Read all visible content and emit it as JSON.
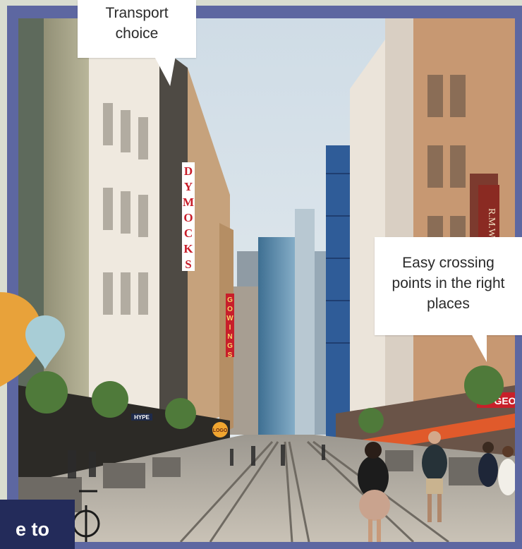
{
  "callouts": {
    "transport": "Transport\nchoice",
    "crossing": "Easy crossing points in the right places"
  },
  "banner": {
    "text": "e to"
  },
  "signs": {
    "dymocks": [
      "D",
      "Y",
      "M",
      "O",
      "C",
      "K",
      "S"
    ],
    "gowings": [
      "G",
      "O",
      "W",
      "I",
      "N",
      "G",
      "S"
    ],
    "rmw": "R.M.W",
    "hype": "HYPE",
    "geo": "GEO",
    "logo": "LOGO"
  },
  "colors": {
    "frame": "#5d67a1",
    "background": "#d9ddd0",
    "banner": "#232b5a",
    "pin_orange": "#e8a23a",
    "pin_blue": "#a8cdd6"
  }
}
